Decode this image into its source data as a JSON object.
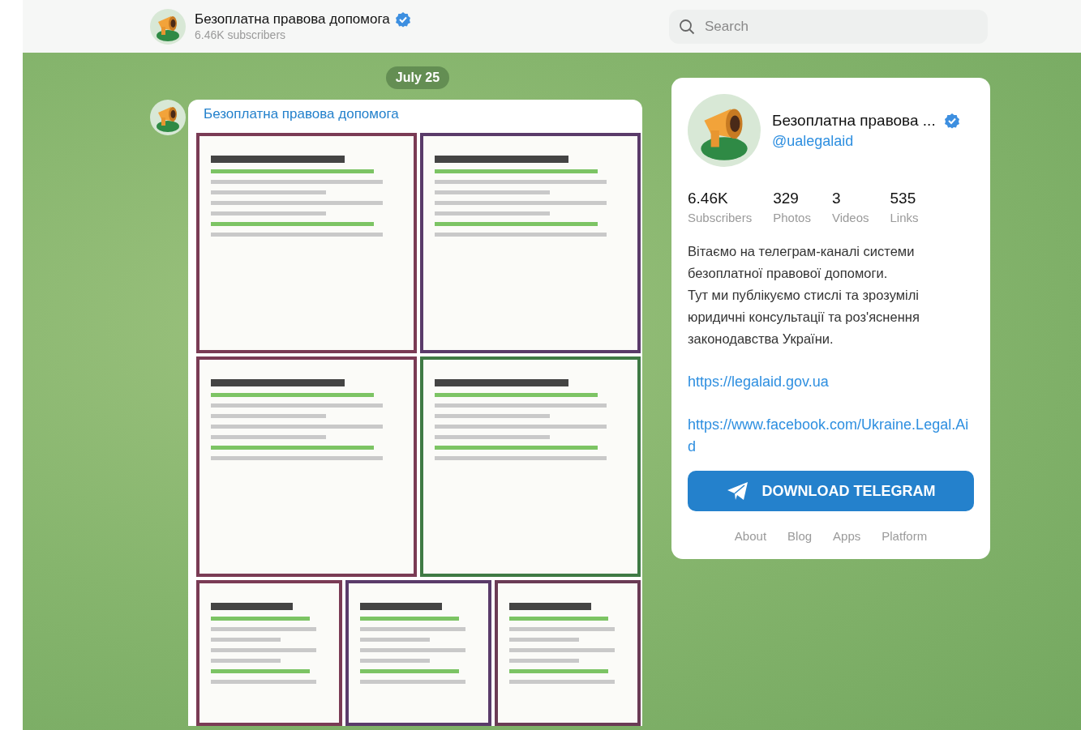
{
  "header": {
    "channel_name": "Безоплатна правова допомога",
    "verified": true,
    "subscribers": "6.46K subscribers"
  },
  "search": {
    "placeholder": "Search"
  },
  "date_badge": "July 25",
  "post": {
    "author": "Безоплатна правова допомога"
  },
  "channel_card": {
    "name": "Безоплатна правова ...",
    "verified": true,
    "username": "@ualegalaid",
    "stats": [
      {
        "value": "6.46K",
        "label": "Subscribers"
      },
      {
        "value": "329",
        "label": "Photos"
      },
      {
        "value": "3",
        "label": "Videos"
      },
      {
        "value": "535",
        "label": "Links"
      }
    ],
    "description": [
      "Вітаємо на телеграм-каналі системи безоплатної правової допомоги.",
      "Тут ми публікуємо стислі та зрозумілі юридичні консультації та роз'яснення законодавства України."
    ],
    "links": [
      "https://legalaid.gov.ua",
      "https://www.facebook.com/Ukraine.Legal.Aid"
    ],
    "download_button": "DOWNLOAD TELEGRAM",
    "footer_links": [
      "About",
      "Blog",
      "Apps",
      "Platform"
    ]
  }
}
